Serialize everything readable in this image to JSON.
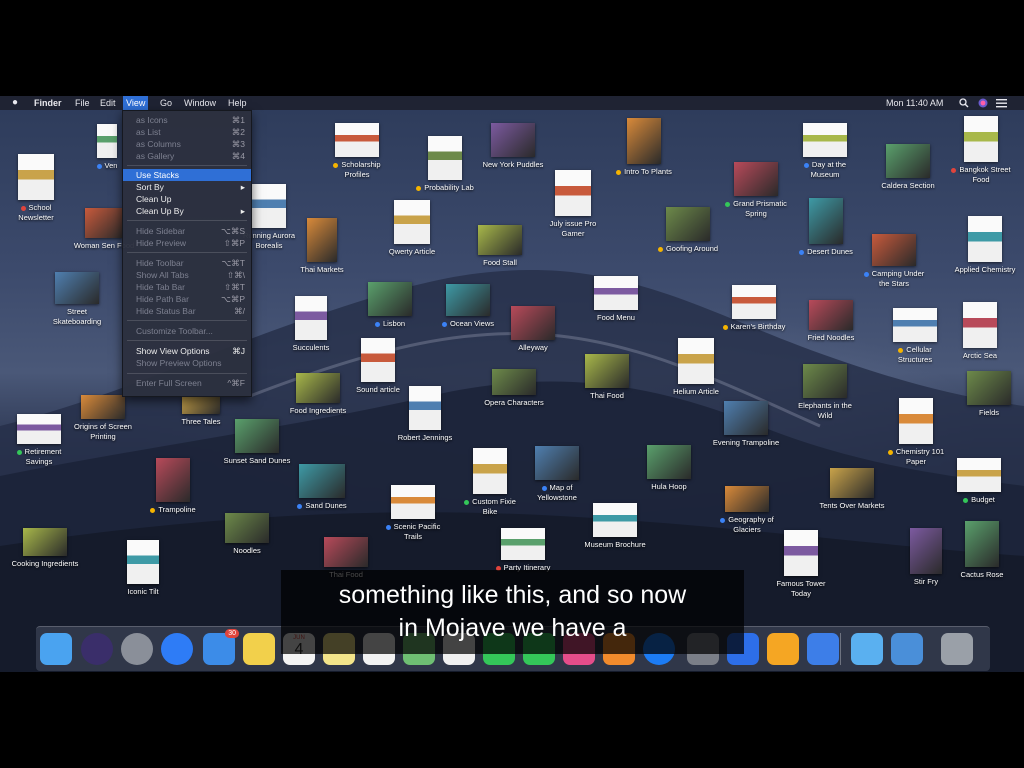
{
  "menubar": {
    "apple_icon": "apple-icon",
    "app": "Finder",
    "items": [
      "File",
      "Edit",
      "View",
      "Go",
      "Window",
      "Help"
    ],
    "clock": "Mon 11:40 AM",
    "right_icons": [
      "spotlight-icon",
      "siri-icon",
      "notification-center-icon"
    ]
  },
  "view_menu": {
    "items": [
      {
        "label": "as Icons",
        "shortcut": "⌘1"
      },
      {
        "label": "as List",
        "shortcut": "⌘2"
      },
      {
        "label": "as Columns",
        "shortcut": "⌘3"
      },
      {
        "label": "as Gallery",
        "shortcut": "⌘4"
      },
      {
        "label": "Use Stacks",
        "shortcut": ""
      },
      {
        "label": "Sort By",
        "shortcut": "▸"
      },
      {
        "label": "Clean Up",
        "shortcut": ""
      },
      {
        "label": "Clean Up By",
        "shortcut": "▸"
      },
      {
        "label": "Hide Sidebar",
        "shortcut": "⌥⌘S"
      },
      {
        "label": "Hide Preview",
        "shortcut": "⇧⌘P"
      },
      {
        "label": "Hide Toolbar",
        "shortcut": "⌥⌘T"
      },
      {
        "label": "Show All Tabs",
        "shortcut": "⇧⌘\\"
      },
      {
        "label": "Hide Tab Bar",
        "shortcut": "⇧⌘T"
      },
      {
        "label": "Hide Path Bar",
        "shortcut": "⌥⌘P"
      },
      {
        "label": "Hide Status Bar",
        "shortcut": "⌘/"
      },
      {
        "label": "Customize Toolbar...",
        "shortcut": ""
      },
      {
        "label": "Show View Options",
        "shortcut": "⌘J"
      },
      {
        "label": "Show Preview Options",
        "shortcut": ""
      },
      {
        "label": "Enter Full Screen",
        "shortcut": "^⌘F"
      }
    ]
  },
  "files": [
    {
      "name": "School Newsletter",
      "tag": "#e0443c"
    },
    {
      "name": "Ven",
      "tag": "#3b82f6"
    },
    {
      "name": "Woman Sen Food",
      "tag": ""
    },
    {
      "name": "Street Skateboarding",
      "tag": ""
    },
    {
      "name": "Origins of Screen Printing",
      "tag": ""
    },
    {
      "name": "Retirement Savings",
      "tag": "#34c759"
    },
    {
      "name": "Cooking Ingredients",
      "tag": ""
    },
    {
      "name": "Iconic Tilt",
      "tag": ""
    },
    {
      "name": "Trampoline",
      "tag": "#f5b400"
    },
    {
      "name": "Noodles",
      "tag": ""
    },
    {
      "name": "Three Tales",
      "tag": ""
    },
    {
      "name": "Sunset Sand Dunes",
      "tag": ""
    },
    {
      "name": "Scholarship Profiles",
      "tag": "#f5b400"
    },
    {
      "name": "Running Aurora Borealis",
      "tag": ""
    },
    {
      "name": "Thai Markets",
      "tag": ""
    },
    {
      "name": "Succulents",
      "tag": ""
    },
    {
      "name": "Food Ingredients",
      "tag": ""
    },
    {
      "name": "Sand Dunes",
      "tag": "#3b82f6"
    },
    {
      "name": "Thai Food",
      "tag": ""
    },
    {
      "name": "Probability Lab",
      "tag": "#f5b400"
    },
    {
      "name": "Qwerty Article",
      "tag": ""
    },
    {
      "name": "Lisbon",
      "tag": "#3b82f6"
    },
    {
      "name": "Sound article",
      "tag": ""
    },
    {
      "name": "Robert Jennings",
      "tag": ""
    },
    {
      "name": "Scenic Pacific Trails",
      "tag": "#3b82f6"
    },
    {
      "name": "New York Puddles",
      "tag": ""
    },
    {
      "name": "Food Stall",
      "tag": ""
    },
    {
      "name": "Ocean Views",
      "tag": "#3b82f6"
    },
    {
      "name": "Alleyway",
      "tag": ""
    },
    {
      "name": "Opera Characters",
      "tag": ""
    },
    {
      "name": "Custom Fixie Bike",
      "tag": "#34c759"
    },
    {
      "name": "Party Itinerary",
      "tag": "#e0443c"
    },
    {
      "name": "July issue Pro Gamer",
      "tag": ""
    },
    {
      "name": "Map of Yellowstone",
      "tag": "#3b82f6"
    },
    {
      "name": "Intro To Plants",
      "tag": "#f5b400"
    },
    {
      "name": "Food Menu",
      "tag": ""
    },
    {
      "name": "Thai Food",
      "tag": ""
    },
    {
      "name": "Museum Brochure",
      "tag": ""
    },
    {
      "name": "Grand Prismatic Spring",
      "tag": "#34c759"
    },
    {
      "name": "Goofing Around",
      "tag": "#f5b400"
    },
    {
      "name": "Helium Article",
      "tag": ""
    },
    {
      "name": "Hula Hoop",
      "tag": ""
    },
    {
      "name": "Karen's Birthday",
      "tag": "#f5b400"
    },
    {
      "name": "Evening Trampoline",
      "tag": ""
    },
    {
      "name": "Geography of Glaciers",
      "tag": "#3b82f6"
    },
    {
      "name": "Famous Tower Today",
      "tag": ""
    },
    {
      "name": "Day at the Museum",
      "tag": "#3b82f6"
    },
    {
      "name": "Desert Dunes",
      "tag": "#3b82f6"
    },
    {
      "name": "Fried Noodles",
      "tag": ""
    },
    {
      "name": "Elephants in the Wild",
      "tag": ""
    },
    {
      "name": "Tents Over Markets",
      "tag": ""
    },
    {
      "name": "Caldera Section",
      "tag": ""
    },
    {
      "name": "Camping Under the Stars",
      "tag": "#3b82f6"
    },
    {
      "name": "Cellular Structures",
      "tag": "#f5b400"
    },
    {
      "name": "Chemistry 101 Paper",
      "tag": "#f5b400"
    },
    {
      "name": "Stir Fry",
      "tag": ""
    },
    {
      "name": "Bangkok Street Food",
      "tag": "#e0443c"
    },
    {
      "name": "Applied Chemistry",
      "tag": ""
    },
    {
      "name": "Arctic Sea",
      "tag": ""
    },
    {
      "name": "Fields",
      "tag": ""
    },
    {
      "name": "Budget",
      "tag": "#34c759"
    },
    {
      "name": "Cactus Rose",
      "tag": ""
    }
  ],
  "dock": {
    "apps": [
      "finder-icon",
      "siri-icon",
      "launchpad-icon",
      "safari-icon",
      "mail-icon",
      "notes-icon",
      "calendar-icon",
      "stickies-icon",
      "reminders-icon",
      "maps-icon",
      "photos-icon",
      "messages-icon",
      "facetime-icon",
      "itunes-icon",
      "books-icon",
      "app-store-icon",
      "system-preferences-icon",
      "keynote-icon",
      "pages-icon",
      "xcode-icon",
      "folder-icon",
      "downloads-icon",
      "trash-icon"
    ],
    "mail_badge": "30",
    "calendar_month": "JUN",
    "calendar_day": "4"
  },
  "caption": {
    "line1": "something like this, and so now",
    "line2": "in Mojave we have a"
  },
  "colors": {
    "menu_highlight": "#2f6fd6",
    "tag_red": "#e0443c",
    "tag_blue": "#3b82f6",
    "tag_yellow": "#f5b400",
    "tag_green": "#34c759"
  }
}
